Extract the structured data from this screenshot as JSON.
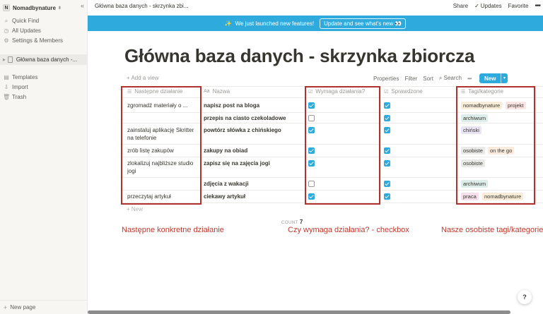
{
  "sidebar": {
    "workspace_initial": "N",
    "workspace": "Nomadbynature",
    "items": [
      {
        "label": "Quick Find",
        "icon": "search-icon"
      },
      {
        "label": "All Updates",
        "icon": "clock-icon"
      },
      {
        "label": "Settings & Members",
        "icon": "gear-icon"
      }
    ],
    "page": "Główna baza danych -...",
    "bottom_items": [
      {
        "label": "Templates",
        "icon": "templates-icon"
      },
      {
        "label": "Import",
        "icon": "import-icon"
      },
      {
        "label": "Trash",
        "icon": "trash-icon"
      }
    ],
    "new_page": "New page"
  },
  "topbar": {
    "breadcrumb": "Główna baza danych - skrzynka zbi...",
    "share": "Share",
    "updates": "Updates",
    "favorite": "Favorite"
  },
  "banner": {
    "text": "We just launched new features!",
    "button": "Update and see what's new 👀"
  },
  "page": {
    "title": "Główna baza danych - skrzynka zbiorcza"
  },
  "viewbar": {
    "add_view": "+ Add a view",
    "properties": "Properties",
    "filter": "Filter",
    "sort": "Sort",
    "search": "Search",
    "new": "New"
  },
  "table": {
    "columns": [
      "Następne działanie",
      "Nazwa",
      "Wymaga działania?",
      "Sprawdzone",
      "Tagi/kategorie"
    ],
    "rows": [
      {
        "next": "zgromadź materiały o ...",
        "name": "napisz post na bloga",
        "requires": true,
        "checked": true,
        "tags": [
          {
            "label": "nomadbynature",
            "color": "#f9ecd8"
          },
          {
            "label": "projekt",
            "color": "#fbe4e4"
          }
        ]
      },
      {
        "next": "",
        "name": "przepis na ciasto czekoladowe",
        "requires": false,
        "checked": true,
        "tags": [
          {
            "label": "archiwum",
            "color": "#ddedea"
          }
        ]
      },
      {
        "next": "zainstaluj aplikację Skritter na telefonie",
        "name": "powtórz słówka z chińskiego",
        "requires": true,
        "checked": true,
        "tags": [
          {
            "label": "chiński",
            "color": "#eae4f2"
          }
        ]
      },
      {
        "next": "zrób listę zakupów",
        "name": "zakupy na obiad",
        "requires": true,
        "checked": true,
        "tags": [
          {
            "label": "osobiste",
            "color": "#e9e9e7"
          },
          {
            "label": "on the go",
            "color": "#faebdd"
          }
        ]
      },
      {
        "next": "zlokalizuj najbliższe studio jogi",
        "name": "zapisz się na zajęcia jogi",
        "requires": true,
        "checked": true,
        "tags": [
          {
            "label": "osobiste",
            "color": "#e9e9e7"
          }
        ]
      },
      {
        "next": "",
        "name": "zdjęcia z wakacji",
        "requires": false,
        "checked": true,
        "tags": [
          {
            "label": "archiwum",
            "color": "#ddedea"
          }
        ]
      },
      {
        "next": "przeczytaj artykuł",
        "name": "ciekawy artykuł",
        "requires": true,
        "checked": true,
        "tags": [
          {
            "label": "praca",
            "color": "#f4dfeb"
          },
          {
            "label": "nomadbynature",
            "color": "#f9ecd8"
          }
        ]
      }
    ],
    "add_new": "+ New",
    "count_label": "COUNT",
    "count_value": "7"
  },
  "annotations": {
    "next_action": "Następne konkretne działanie",
    "requires": "Czy wymaga działania? - checkbox",
    "tags": "Nasze osobiste tagi/kategorie"
  },
  "help": "?",
  "colors": {
    "accent": "#2eaadc",
    "annotation_red": "#b0322f"
  }
}
